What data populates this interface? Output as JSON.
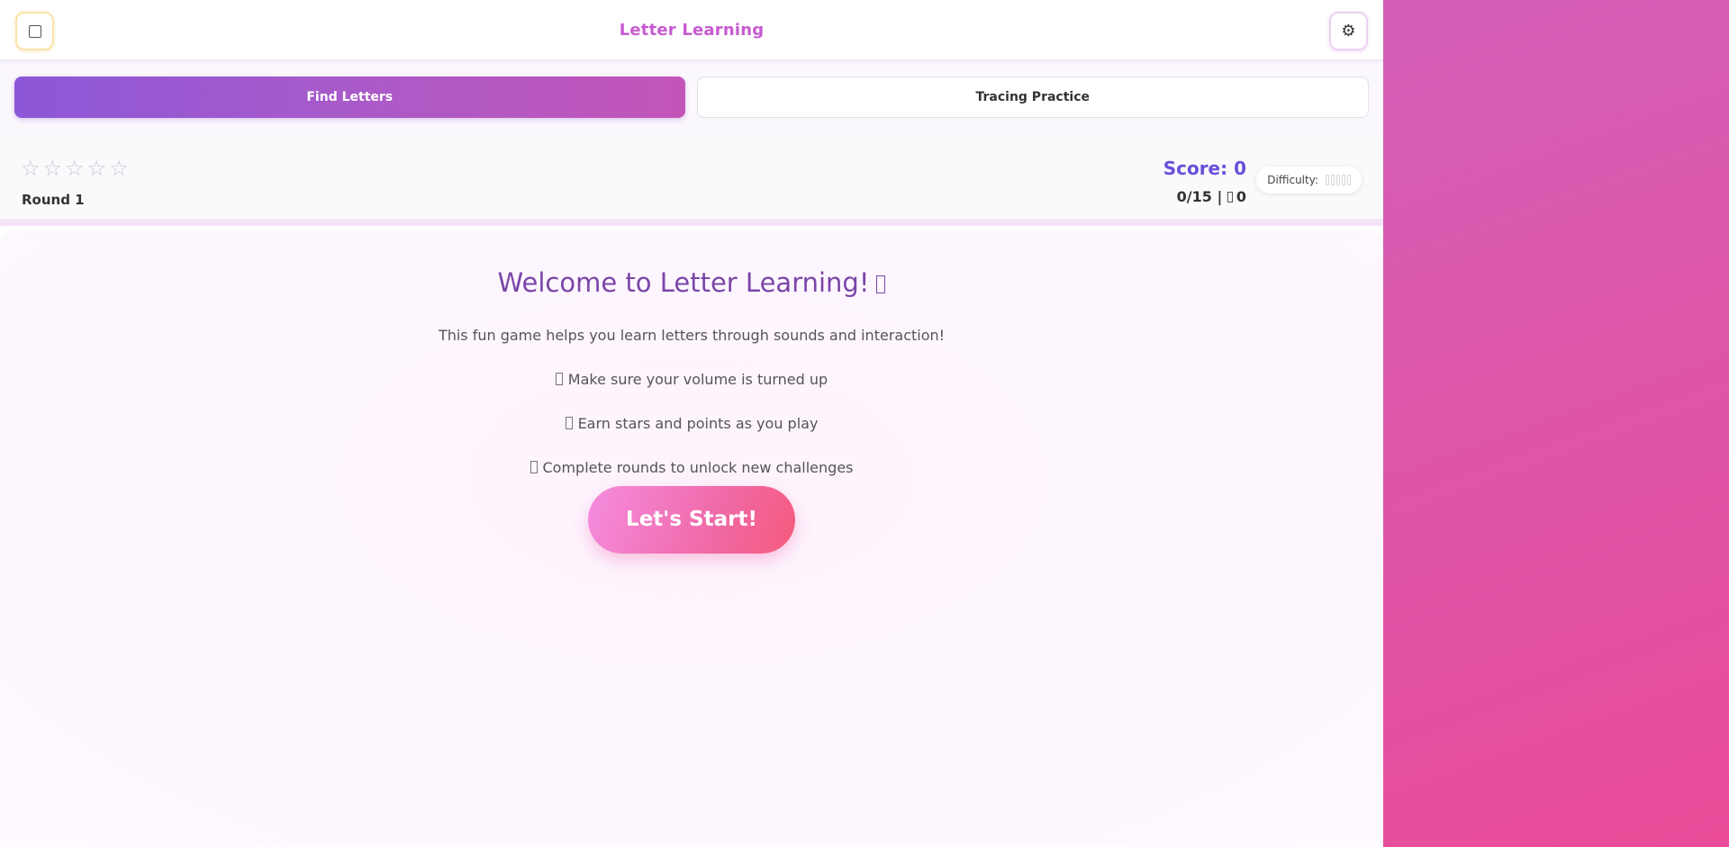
{
  "header": {
    "title": "Letter Learning",
    "home_icon": "home-icon",
    "settings_icon": "gear-icon",
    "settings_glyph": "⚙"
  },
  "tabs": [
    {
      "label": "Find Letters",
      "active": true
    },
    {
      "label": "Tracing Practice",
      "active": false
    }
  ],
  "stats": {
    "stars_total": 5,
    "stars_earned": 0,
    "star_glyph": "☆",
    "round_label": "Round 1",
    "score_label": "Score: 0",
    "progress_text": "0/15 | ",
    "streak_value": "0",
    "difficulty_label": "Difficulty:",
    "difficulty_level": 0,
    "difficulty_max": 5
  },
  "welcome": {
    "title": "Welcome to Letter Learning!",
    "description": "This fun game helps you learn letters through sounds and interaction!",
    "tips": [
      "Make sure your volume is turned up",
      "Earn stars and points as you play",
      "Complete rounds to unlock new challenges"
    ],
    "start_label": "Let's Start!"
  },
  "colors": {
    "accent": "#8c57d8",
    "title": "#c65bd0",
    "score": "#6a4fd8",
    "start_button": "#f06aa8"
  }
}
